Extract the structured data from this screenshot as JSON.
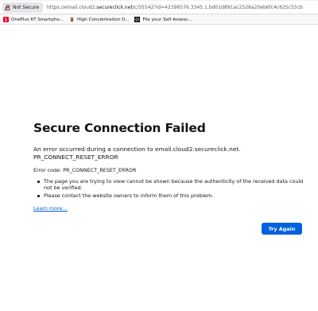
{
  "browser": {
    "security_label": "Not Secure",
    "url_prefix": "https://email.cloud2.",
    "url_host": "secureclick.net",
    "url_path": "/c/55542?id=42398576.3345.1.bd01d891ac2528a20eb6fc4c625c55cb",
    "bookmarks": [
      {
        "label": "OnePlus 6T Smartpho...",
        "icon": "oneplus-icon"
      },
      {
        "label": "High Concentration O...",
        "icon": "leaf-icon"
      },
      {
        "label": "File your Self Assess...",
        "icon": "govuk-icon"
      }
    ]
  },
  "error": {
    "title": "Secure Connection Failed",
    "intro": "An error occurred during a connection to email.cloud2.secureclick.net. PR_CONNECT_RESET_ERROR",
    "code_line": "Error code: PR_CONNECT_RESET_ERROR",
    "bullets": [
      "The page you are trying to view cannot be shown because the authenticity of the received data could not be verified.",
      "Please contact the website owners to inform them of this problem."
    ],
    "learn_more": "Learn more…",
    "try_again": "Try Again"
  },
  "colors": {
    "accent": "#0061e0",
    "text": "#15141a"
  }
}
